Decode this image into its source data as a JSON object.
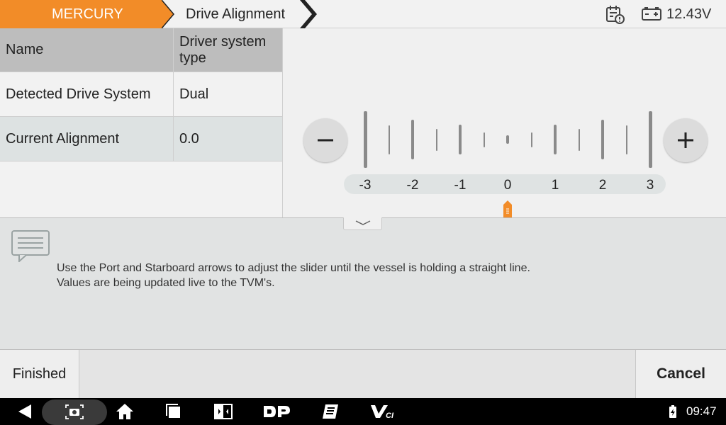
{
  "header": {
    "brand": "MERCURY",
    "page_title": "Drive Alignment",
    "voltage": "12.43V",
    "brand_color": "#f28c28"
  },
  "table": {
    "header": {
      "name": "Name",
      "value": "Driver system type"
    },
    "rows": [
      {
        "name": "Detected Drive System",
        "value": "Dual"
      },
      {
        "name": "Current Alignment",
        "value": "0.0"
      }
    ]
  },
  "slider": {
    "labels": [
      "-3",
      "-2",
      "-1",
      "0",
      "1",
      "2",
      "3"
    ],
    "current_value": 0.0,
    "min": -3,
    "max": 3,
    "marker_color": "#f28c28"
  },
  "message": {
    "line1": "Use the Port and Starboard arrows to adjust the slider until the vessel is holding a straight line.",
    "line2": "Values are being updated live to the TVM's."
  },
  "footer": {
    "finished_label": "Finished",
    "cancel_label": "Cancel"
  },
  "system_bar": {
    "time": "09:47",
    "icons": [
      "back-icon",
      "screenshot-icon",
      "home-icon",
      "recents-icon",
      "screen-mirror-icon",
      "dp-icon",
      "diagnostic-report-icon",
      "vci-icon",
      "wifi-icon",
      "battery-icon"
    ]
  }
}
